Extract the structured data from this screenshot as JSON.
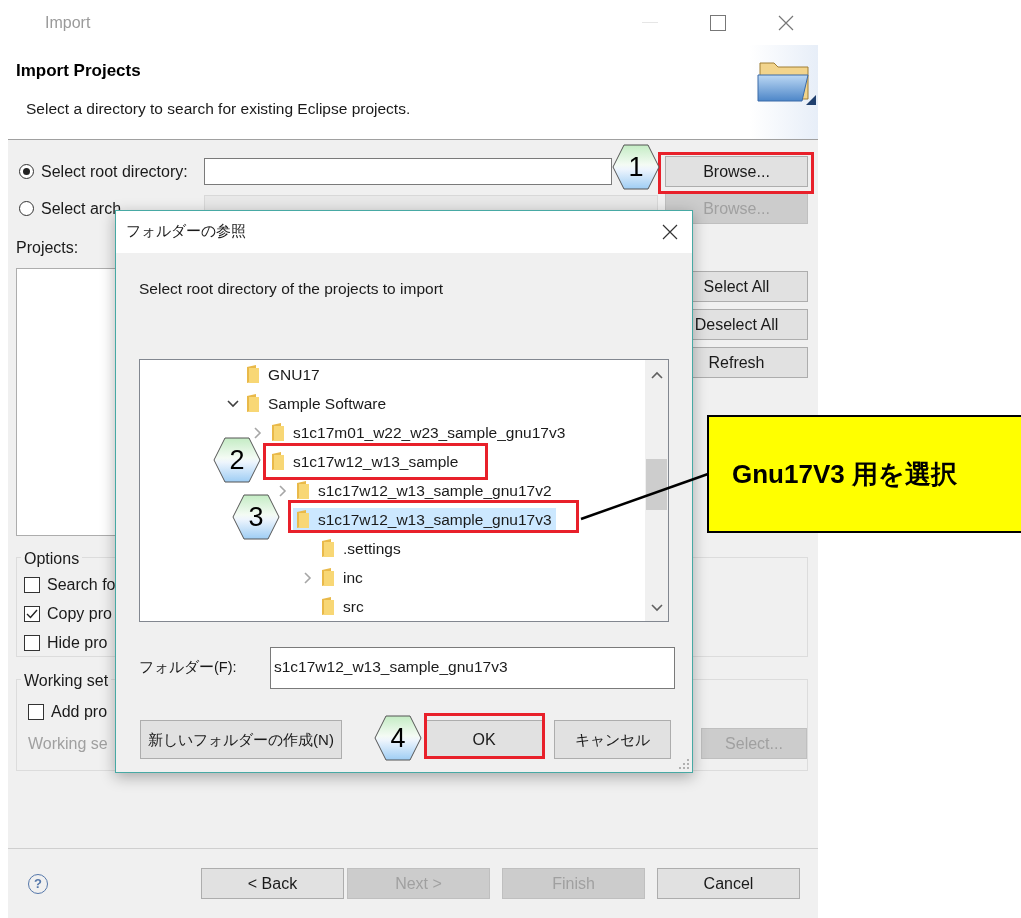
{
  "window": {
    "title": "Import"
  },
  "header": {
    "title": "Import Projects",
    "description": "Select a directory to search for existing Eclipse projects."
  },
  "sources": [
    {
      "label": "Select root directory:",
      "selected": true,
      "field_disabled": false,
      "button": {
        "label": "Browse...",
        "disabled": false
      }
    },
    {
      "label": "Select arch",
      "selected": false,
      "field_disabled": true,
      "button": {
        "label": "Browse...",
        "disabled": true
      }
    }
  ],
  "projects": {
    "label": "Projects:",
    "buttons": [
      {
        "label": "Select All",
        "disabled": false
      },
      {
        "label": "Deselect All",
        "disabled": false
      },
      {
        "label": "Refresh",
        "disabled": false
      }
    ]
  },
  "options": {
    "title": "Options",
    "checkboxes": [
      {
        "label": "Search fo",
        "checked": false
      },
      {
        "label": "Copy pro",
        "checked": true
      },
      {
        "label": "Hide pro",
        "checked": false
      }
    ]
  },
  "working_sets": {
    "title": "Working set",
    "checkbox": {
      "label": "Add pro",
      "checked": false
    },
    "field_label": "Working se",
    "disabled": true,
    "button": {
      "label": "Select...",
      "disabled": true
    }
  },
  "help": "?",
  "footer_buttons": [
    {
      "label": "< Back",
      "disabled": false
    },
    {
      "label": "Next >",
      "disabled": true
    },
    {
      "label": "Finish",
      "disabled": true
    },
    {
      "label": "Cancel",
      "disabled": false
    }
  ],
  "folder_dialog": {
    "title": "フォルダーの参照",
    "prompt": "Select root directory of the projects to import",
    "tree": [
      {
        "label": "GNU17",
        "selected": false
      },
      {
        "label": "Sample Software",
        "expanded": true,
        "selected": false,
        "children": [
          {
            "label": "s1c17m01_w22_w23_sample_gnu17v3",
            "expanded": false,
            "selected": false
          },
          {
            "label": "s1c17w12_w13_sample",
            "selected": false,
            "children": [
              {
                "label": "s1c17w12_w13_sample_gnu17v2",
                "expanded": false,
                "selected": false
              },
              {
                "label": "s1c17w12_w13_sample_gnu17v3",
                "selected": true,
                "children": [
                  {
                    "label": ".settings",
                    "selected": false
                  },
                  {
                    "label": "inc",
                    "expanded": false,
                    "selected": false
                  },
                  {
                    "label": "src",
                    "selected": false
                  }
                ]
              }
            ]
          }
        ]
      }
    ],
    "folder_label": "フォルダー(F):",
    "folder_value": "s1c17w12_w13_sample_gnu17v3",
    "buttons": [
      {
        "label": "新しいフォルダーの作成(N)"
      },
      {
        "label": "OK"
      },
      {
        "label": "キャンセル"
      }
    ]
  },
  "annotations": {
    "steps": [
      "1",
      "2",
      "3",
      "4"
    ],
    "note": "Gnu17V3 用を選択"
  }
}
